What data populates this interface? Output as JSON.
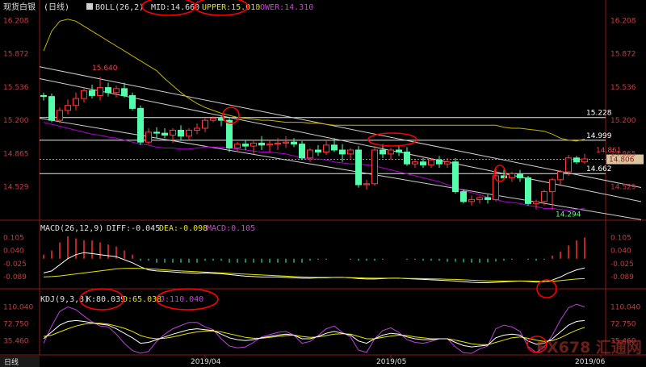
{
  "header": {
    "symbol": "现货白银",
    "period": "(日线)",
    "indicator": "BOLL(26,2)",
    "mid": "MID:14.660",
    "upper": "UPPER:15.010",
    "lower": "LOWER:14.310"
  },
  "macd_header": {
    "name": "MACD(26,12,9)",
    "diff": "DIFF:-0.045",
    "dea": "DEA:-0.098",
    "macd": "MACD:0.105"
  },
  "kdj_header": {
    "name": "KDJ(9,3,3)",
    "k": "K:80.039",
    "d": "D:65.038",
    "j": "J:110.040"
  },
  "colors": {
    "background": "#000000",
    "up_candle": "#ff3b3b",
    "down_candle": "#54ffab",
    "boll_upper": "#c8b400",
    "boll_lower": "#b000d0",
    "trend_line": "#d0d0d0",
    "axis_text": "#c83c3c",
    "annotation": "#ff0000",
    "diff_line": "#ffffff",
    "dea_line": "#e6e600",
    "macd_bar_pos": "#ff3030",
    "macd_bar_neg": "#1fb380",
    "kdj_k": "#ffffff",
    "kdj_d": "#e6e600",
    "kdj_j": "#c040e0"
  },
  "bottom_bar": {
    "label": "日线",
    "watermark": "FX678 汇通网"
  },
  "chart_data": [
    {
      "type": "candlestick",
      "title": "现货白银 (日线)",
      "y_ticks": [
        "16.208",
        "15.872",
        "15.536",
        "15.200",
        "14.865",
        "14.529"
      ],
      "ylim": [
        14.2,
        16.3
      ],
      "x_ticks": [
        "2019/04",
        "2019/05",
        "2019/06"
      ],
      "x_tick_index": [
        20,
        43,
        69
      ],
      "current_price_label": "14.806",
      "annotations": [
        "15.640",
        "15.228",
        "14.999",
        "14.861",
        "14.662",
        "14.294"
      ],
      "levels": [
        15.228,
        14.999,
        14.662
      ],
      "last_price": 14.806,
      "high_label": {
        "text": "15.640",
        "index": 7,
        "value": 15.64
      },
      "low_label": {
        "text": "14.294",
        "index": 63,
        "value": 14.294
      },
      "recent_high_label": {
        "text": "14.861",
        "index": 68,
        "value": 14.861
      },
      "candles": [
        [
          15.45,
          15.48,
          15.4,
          15.44
        ],
        [
          15.44,
          15.47,
          15.18,
          15.2
        ],
        [
          15.2,
          15.33,
          15.17,
          15.3
        ],
        [
          15.3,
          15.41,
          15.26,
          15.35
        ],
        [
          15.35,
          15.48,
          15.3,
          15.42
        ],
        [
          15.42,
          15.52,
          15.38,
          15.5
        ],
        [
          15.5,
          15.56,
          15.42,
          15.45
        ],
        [
          15.45,
          15.64,
          15.4,
          15.53
        ],
        [
          15.53,
          15.58,
          15.44,
          15.48
        ],
        [
          15.48,
          15.55,
          15.43,
          15.52
        ],
        [
          15.52,
          15.58,
          15.43,
          15.45
        ],
        [
          15.45,
          15.48,
          15.3,
          15.32
        ],
        [
          15.32,
          15.35,
          14.95,
          14.98
        ],
        [
          14.98,
          15.12,
          14.96,
          15.08
        ],
        [
          15.08,
          15.13,
          15.02,
          15.07
        ],
        [
          15.07,
          15.12,
          15.02,
          15.05
        ],
        [
          15.05,
          15.12,
          14.97,
          15.1
        ],
        [
          15.1,
          15.15,
          15.0,
          15.04
        ],
        [
          15.04,
          15.12,
          15.0,
          15.1
        ],
        [
          15.1,
          15.17,
          15.06,
          15.12
        ],
        [
          15.12,
          15.22,
          15.08,
          15.2
        ],
        [
          15.2,
          15.24,
          15.18,
          15.22
        ],
        [
          15.22,
          15.25,
          15.14,
          15.2
        ],
        [
          15.2,
          15.23,
          14.88,
          14.92
        ],
        [
          14.92,
          14.98,
          14.88,
          14.96
        ],
        [
          14.96,
          15.0,
          14.9,
          14.94
        ],
        [
          14.94,
          15.0,
          14.86,
          14.97
        ],
        [
          14.97,
          15.04,
          14.9,
          14.95
        ],
        [
          14.95,
          15.0,
          14.88,
          14.96
        ],
        [
          14.96,
          15.02,
          14.9,
          14.97
        ],
        [
          14.97,
          15.04,
          14.92,
          14.98
        ],
        [
          14.98,
          15.02,
          14.93,
          14.96
        ],
        [
          14.96,
          14.99,
          14.8,
          14.82
        ],
        [
          14.82,
          14.92,
          14.78,
          14.9
        ],
        [
          14.9,
          14.95,
          14.84,
          14.88
        ],
        [
          14.88,
          15.0,
          14.85,
          14.95
        ],
        [
          14.95,
          15.02,
          14.88,
          14.9
        ],
        [
          14.9,
          14.96,
          14.78,
          14.86
        ],
        [
          14.86,
          14.92,
          14.8,
          14.9
        ],
        [
          14.9,
          14.94,
          14.52,
          14.55
        ],
        [
          14.55,
          14.6,
          14.5,
          14.56
        ],
        [
          14.56,
          14.94,
          14.54,
          14.9
        ],
        [
          14.9,
          14.96,
          14.82,
          14.86
        ],
        [
          14.86,
          14.92,
          14.8,
          14.9
        ],
        [
          14.9,
          14.95,
          14.84,
          14.88
        ],
        [
          14.88,
          14.93,
          14.74,
          14.76
        ],
        [
          14.76,
          14.8,
          14.72,
          14.78
        ],
        [
          14.78,
          14.82,
          14.72,
          14.75
        ],
        [
          14.75,
          14.82,
          14.72,
          14.8
        ],
        [
          14.8,
          14.84,
          14.72,
          14.76
        ],
        [
          14.76,
          14.82,
          14.72,
          14.78
        ],
        [
          14.78,
          14.82,
          14.46,
          14.48
        ],
        [
          14.48,
          14.5,
          14.36,
          14.38
        ],
        [
          14.38,
          14.44,
          14.34,
          14.4
        ],
        [
          14.4,
          14.44,
          14.36,
          14.42
        ],
        [
          14.42,
          14.45,
          14.36,
          14.4
        ],
        [
          14.4,
          14.72,
          14.38,
          14.64
        ],
        [
          14.64,
          14.7,
          14.6,
          14.62
        ],
        [
          14.62,
          14.68,
          14.58,
          14.66
        ],
        [
          14.66,
          14.7,
          14.58,
          14.62
        ],
        [
          14.62,
          14.64,
          14.34,
          14.36
        ],
        [
          14.36,
          14.4,
          14.3,
          14.38
        ],
        [
          14.38,
          14.5,
          14.34,
          14.48
        ],
        [
          14.48,
          14.62,
          14.294,
          14.6
        ],
        [
          14.6,
          14.7,
          14.55,
          14.68
        ],
        [
          14.68,
          14.85,
          14.64,
          14.82
        ],
        [
          14.82,
          14.84,
          14.76,
          14.78
        ],
        [
          14.78,
          14.861,
          14.76,
          14.81
        ]
      ],
      "boll_upper": [
        15.9,
        16.1,
        16.2,
        16.22,
        16.2,
        16.15,
        16.1,
        16.05,
        16.0,
        15.95,
        15.9,
        15.85,
        15.8,
        15.75,
        15.7,
        15.62,
        15.55,
        15.48,
        15.42,
        15.37,
        15.33,
        15.3,
        15.27,
        15.25,
        15.23,
        15.22,
        15.21,
        15.2,
        15.2,
        15.19,
        15.18,
        15.18,
        15.18,
        15.17,
        15.17,
        15.16,
        15.15,
        15.15,
        15.15,
        15.15,
        15.15,
        15.15,
        15.15,
        15.15,
        15.15,
        15.15,
        15.15,
        15.15,
        15.15,
        15.15,
        15.15,
        15.15,
        15.15,
        15.15,
        15.15,
        15.15,
        15.15,
        15.13,
        15.12,
        15.12,
        15.11,
        15.1,
        15.09,
        15.06,
        15.02,
        15.0,
        14.99,
        15.01
      ],
      "boll_lower": [
        15.18,
        15.16,
        15.14,
        15.12,
        15.1,
        15.08,
        15.06,
        15.05,
        15.03,
        15.02,
        15.0,
        14.98,
        14.96,
        14.95,
        14.93,
        14.92,
        14.92,
        14.91,
        14.91,
        14.92,
        14.93,
        14.93,
        14.93,
        14.92,
        14.91,
        14.9,
        14.89,
        14.88,
        14.88,
        14.87,
        14.86,
        14.84,
        14.82,
        14.81,
        14.81,
        14.8,
        14.78,
        14.77,
        14.76,
        14.76,
        14.75,
        14.74,
        14.72,
        14.7,
        14.68,
        14.66,
        14.64,
        14.62,
        14.6,
        14.58,
        14.55,
        14.52,
        14.49,
        14.47,
        14.45,
        14.42,
        14.4,
        14.38,
        14.37,
        14.36,
        14.34,
        14.33,
        14.31,
        14.31,
        14.3,
        14.29,
        14.3,
        14.31
      ],
      "trend_lines": [
        {
          "from": [
            0,
            15.74
          ],
          "to": [
            68,
            14.62
          ]
        },
        {
          "from": [
            0,
            15.62
          ],
          "to": [
            68,
            14.48
          ]
        },
        {
          "from": [
            0,
            15.22
          ],
          "to": [
            68,
            14.28
          ]
        }
      ]
    },
    {
      "type": "macd",
      "title": "MACD(26,12,9)",
      "y_ticks": [
        "0.105",
        "0.040",
        "-0.025",
        "-0.089"
      ],
      "ylim": [
        -0.14,
        0.13
      ],
      "series": [
        {
          "name": "DIFF",
          "values": [
            -0.07,
            -0.06,
            -0.03,
            0.0,
            0.02,
            0.03,
            0.025,
            0.02,
            0.015,
            0.01,
            -0.005,
            -0.02,
            -0.04,
            -0.055,
            -0.06,
            -0.062,
            -0.065,
            -0.068,
            -0.07,
            -0.072,
            -0.07,
            -0.072,
            -0.074,
            -0.078,
            -0.082,
            -0.086,
            -0.088,
            -0.09,
            -0.09,
            -0.09,
            -0.092,
            -0.094,
            -0.096,
            -0.096,
            -0.094,
            -0.094,
            -0.092,
            -0.092,
            -0.094,
            -0.098,
            -0.1,
            -0.1,
            -0.098,
            -0.096,
            -0.096,
            -0.098,
            -0.1,
            -0.102,
            -0.104,
            -0.106,
            -0.108,
            -0.11,
            -0.113,
            -0.116,
            -0.118,
            -0.118,
            -0.116,
            -0.114,
            -0.112,
            -0.11,
            -0.112,
            -0.115,
            -0.113,
            -0.105,
            -0.09,
            -0.07,
            -0.055,
            -0.045
          ]
        },
        {
          "name": "DEA",
          "values": [
            -0.09,
            -0.088,
            -0.085,
            -0.08,
            -0.075,
            -0.07,
            -0.065,
            -0.06,
            -0.055,
            -0.05,
            -0.048,
            -0.047,
            -0.048,
            -0.05,
            -0.052,
            -0.055,
            -0.058,
            -0.06,
            -0.062,
            -0.064,
            -0.066,
            -0.068,
            -0.07,
            -0.072,
            -0.074,
            -0.076,
            -0.078,
            -0.08,
            -0.082,
            -0.084,
            -0.086,
            -0.088,
            -0.09,
            -0.091,
            -0.092,
            -0.092,
            -0.092,
            -0.092,
            -0.093,
            -0.094,
            -0.095,
            -0.096,
            -0.096,
            -0.096,
            -0.096,
            -0.097,
            -0.097,
            -0.098,
            -0.099,
            -0.1,
            -0.101,
            -0.102,
            -0.104,
            -0.106,
            -0.108,
            -0.109,
            -0.11,
            -0.11,
            -0.11,
            -0.11,
            -0.11,
            -0.111,
            -0.112,
            -0.111,
            -0.108,
            -0.104,
            -0.1,
            -0.098
          ]
        }
      ],
      "histogram": [
        0.02,
        0.04,
        0.08,
        0.11,
        0.1,
        0.09,
        0.09,
        0.08,
        0.07,
        0.06,
        0.04,
        0.02,
        -0.01,
        -0.01,
        -0.02,
        -0.02,
        -0.02,
        -0.02,
        -0.02,
        -0.02,
        -0.01,
        -0.01,
        -0.01,
        -0.02,
        -0.02,
        -0.02,
        -0.02,
        -0.02,
        -0.02,
        -0.02,
        -0.02,
        -0.02,
        -0.02,
        -0.01,
        -0.005,
        -0.005,
        0.0,
        0.0,
        -0.005,
        -0.01,
        -0.01,
        -0.01,
        -0.005,
        0.0,
        0.0,
        -0.005,
        -0.005,
        -0.01,
        -0.01,
        -0.01,
        -0.015,
        -0.015,
        -0.018,
        -0.02,
        -0.02,
        -0.018,
        -0.014,
        -0.01,
        -0.005,
        0.0,
        -0.005,
        -0.01,
        -0.005,
        0.015,
        0.035,
        0.065,
        0.09,
        0.105
      ]
    },
    {
      "type": "kdj",
      "title": "KDJ(9,3,3)",
      "y_ticks": [
        "110.040",
        "72.750",
        "35.460"
      ],
      "ylim": [
        8,
        118
      ],
      "series": [
        {
          "name": "K",
          "values": [
            40,
            55,
            70,
            78,
            80,
            78,
            75,
            72,
            70,
            62,
            52,
            42,
            30,
            32,
            38,
            44,
            50,
            55,
            60,
            62,
            60,
            58,
            50,
            42,
            38,
            36,
            38,
            42,
            45,
            48,
            50,
            48,
            40,
            40,
            45,
            52,
            56,
            52,
            48,
            35,
            30,
            40,
            48,
            52,
            50,
            44,
            40,
            38,
            38,
            40,
            40,
            32,
            25,
            22,
            24,
            26,
            42,
            48,
            50,
            48,
            35,
            28,
            30,
            40,
            55,
            70,
            78,
            80
          ]
        },
        {
          "name": "D",
          "values": [
            45,
            48,
            55,
            62,
            68,
            72,
            74,
            74,
            72,
            68,
            63,
            56,
            47,
            42,
            40,
            41,
            44,
            48,
            52,
            55,
            57,
            57,
            55,
            51,
            47,
            43,
            41,
            41,
            43,
            45,
            47,
            48,
            45,
            43,
            44,
            47,
            50,
            51,
            50,
            45,
            40,
            40,
            43,
            46,
            48,
            47,
            44,
            42,
            40,
            40,
            40,
            37,
            33,
            29,
            27,
            27,
            32,
            37,
            42,
            44,
            41,
            37,
            34,
            36,
            42,
            51,
            59,
            65
          ]
        },
        {
          "name": "J",
          "values": [
            30,
            68,
            100,
            110,
            104,
            90,
            77,
            68,
            66,
            50,
            30,
            14,
            -4,
            12,
            34,
            50,
            62,
            69,
            76,
            76,
            66,
            60,
            40,
            24,
            20,
            22,
            32,
            44,
            49,
            54,
            56,
            48,
            30,
            34,
            47,
            62,
            68,
            54,
            44,
            15,
            10,
            40,
            58,
            64,
            54,
            38,
            32,
            30,
            34,
            40,
            40,
            22,
            9,
            8,
            18,
            24,
            62,
            70,
            66,
            56,
            23,
            10,
            22,
            48,
            81,
            108,
            116,
            110
          ]
        }
      ]
    }
  ]
}
